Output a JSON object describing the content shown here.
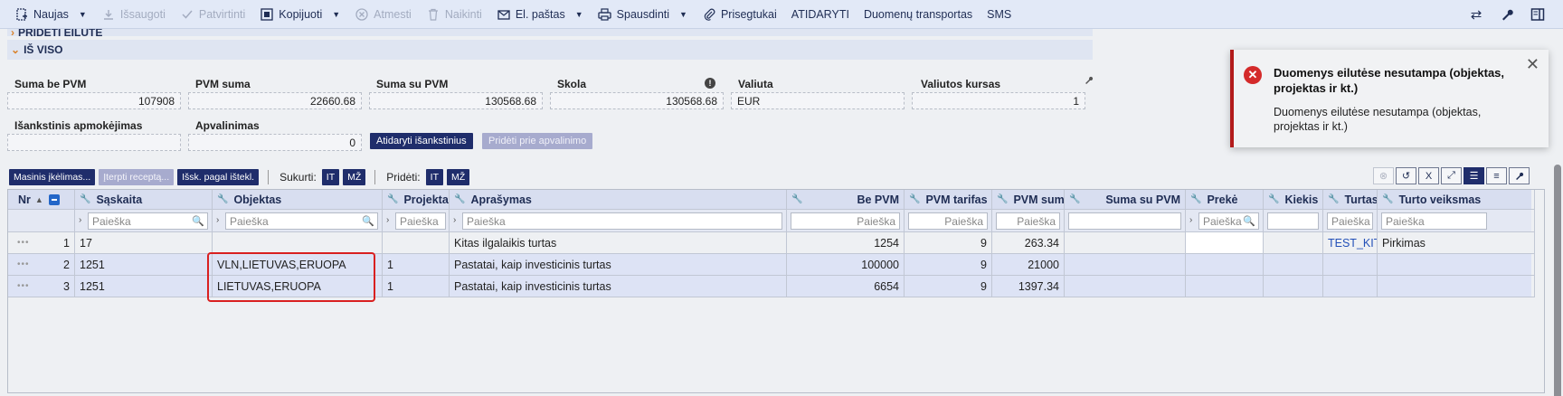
{
  "toolbar": {
    "new": "Naujas",
    "save": "Išsaugoti",
    "confirm": "Patvirtinti",
    "copy": "Kopijuoti",
    "cancel": "Atmesti",
    "delete": "Naikinti",
    "email": "El. paštas",
    "print": "Spausdinti",
    "attachments": "Prisegtukai",
    "open": "ATIDARYTI",
    "transport": "Duomenų transportas",
    "sms": "SMS"
  },
  "sections": {
    "top_partial": "PRIDĖTI EILUTĘ",
    "main": "IŠ VISO"
  },
  "summary": {
    "suma_be_pvm": {
      "label": "Suma be PVM",
      "value": "107908"
    },
    "pvm_suma": {
      "label": "PVM suma",
      "value": "22660.68"
    },
    "suma_su_pvm": {
      "label": "Suma su PVM",
      "value": "130568.68"
    },
    "skola": {
      "label": "Skola",
      "value": "130568.68"
    },
    "valiuta": {
      "label": "Valiuta",
      "value": "EUR"
    },
    "valiutos_kursas": {
      "label": "Valiutos kursas",
      "value": "1"
    },
    "isankstinis": {
      "label": "Išankstinis apmokėjimas",
      "value": ""
    },
    "apvalinimas": {
      "label": "Apvalinimas",
      "value": "0"
    },
    "btn_open_prepay": "Atidaryti išankstinius",
    "btn_add_rounding": "Pridėti prie apvalinimo"
  },
  "grid_toolbar": {
    "mass_entry": "Masinis įkėlimas...",
    "insert_recipe": "Įterpti receptą...",
    "from_resource": "Išsk. pagal ištekl.",
    "create_label": "Sukurti:",
    "add_label": "Pridėti:",
    "it": "IT",
    "mz": "MŽ"
  },
  "grid": {
    "search_placeholder": "Paieška",
    "columns": {
      "nr": "Nr",
      "saskaita": "Sąskaita",
      "objektas": "Objektas",
      "projektas": "Projektas",
      "aprasymas": "Aprašymas",
      "be_pvm": "Be PVM",
      "pvm_tarifas": "PVM tarifas",
      "pvm_suma": "PVM suma",
      "suma_su_pvm": "Suma su PVM",
      "preke": "Prekė",
      "kiekis": "Kiekis",
      "turtas": "Turtas",
      "turto_veiksmas": "Turto veiksmas"
    },
    "rows": [
      {
        "nr": "1",
        "saskaita": "17",
        "objektas": "",
        "projektas": "",
        "aprasymas": "Kitas ilgalaikis turtas",
        "be_pvm": "1254",
        "pvm_tarifas": "9",
        "pvm_suma": "263.34",
        "suma_su_pvm": "",
        "preke": "",
        "kiekis": "",
        "turtas": "TEST_KITI",
        "turto_veiksmas": "Pirkimas"
      },
      {
        "nr": "2",
        "saskaita": "1251",
        "objektas": "VLN,LIETUVAS,ERUOPA",
        "projektas": "1",
        "aprasymas": "Pastatai, kaip investicinis turtas",
        "be_pvm": "100000",
        "pvm_tarifas": "9",
        "pvm_suma": "21000",
        "suma_su_pvm": "",
        "preke": "",
        "kiekis": "",
        "turtas": "",
        "turto_veiksmas": ""
      },
      {
        "nr": "3",
        "saskaita": "1251",
        "objektas": "LIETUVAS,ERUOPA",
        "projektas": "1",
        "aprasymas": "Pastatai, kaip investicinis turtas",
        "be_pvm": "6654",
        "pvm_tarifas": "9",
        "pvm_suma": "1397.34",
        "suma_su_pvm": "",
        "preke": "",
        "kiekis": "",
        "turtas": "",
        "turto_veiksmas": ""
      }
    ]
  },
  "toast": {
    "title": "Duomenys eilutėse nesutampa (objektas, projektas ir kt.)",
    "body": "Duomenys eilutėse nesutampa (objektas, projektas ir kt.)"
  },
  "colors": {
    "accent": "#1f2d6b",
    "error": "#d42a2a",
    "highlight": "#d92020",
    "toolbar_bg": "#e2e9f7"
  }
}
